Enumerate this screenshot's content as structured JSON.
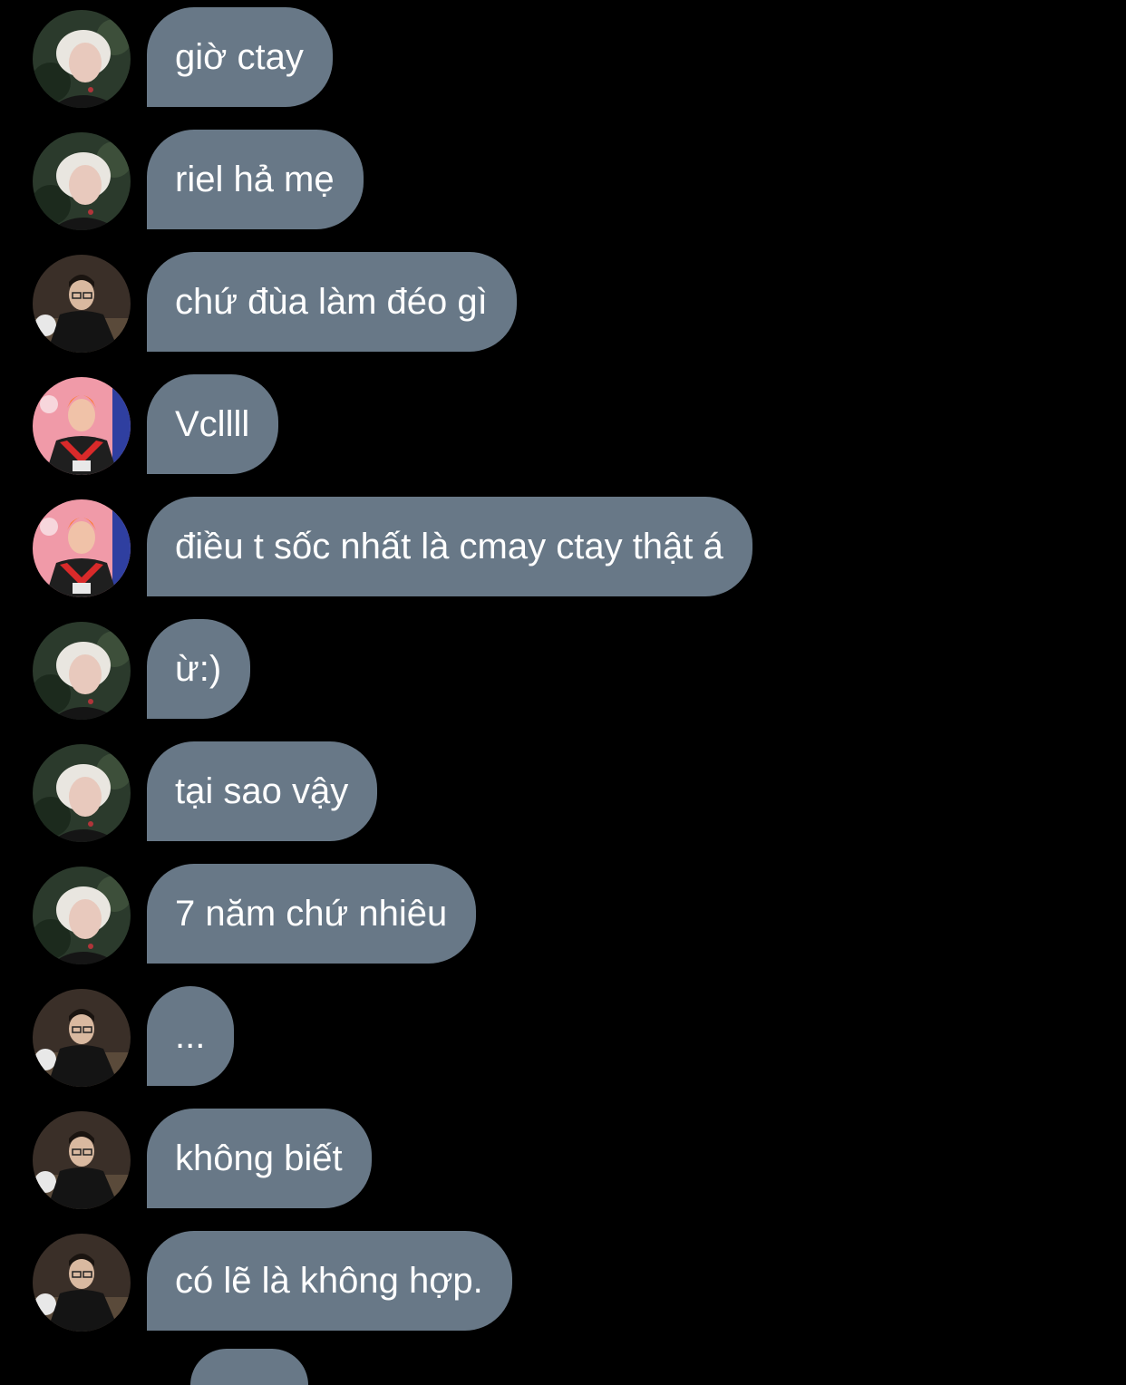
{
  "colors": {
    "background": "#000000",
    "bubble": "#687887",
    "text": "#ffffff"
  },
  "messages": [
    {
      "avatar": "avatar-blonde",
      "text": "giờ ctay"
    },
    {
      "avatar": "avatar-blonde",
      "text": "riel hả mẹ"
    },
    {
      "avatar": "avatar-glasses",
      "text": "chứ đùa làm đéo gì"
    },
    {
      "avatar": "avatar-red-hair",
      "text": "Vcllll"
    },
    {
      "avatar": "avatar-red-hair",
      "text": "điều t sốc nhất là cmay ctay thật á"
    },
    {
      "avatar": "avatar-blonde",
      "text": "ừ:)"
    },
    {
      "avatar": "avatar-blonde",
      "text": "tại sao vậy"
    },
    {
      "avatar": "avatar-blonde",
      "text": "7 năm chứ nhiêu"
    },
    {
      "avatar": "avatar-glasses",
      "text": "..."
    },
    {
      "avatar": "avatar-glasses",
      "text": "không biết"
    },
    {
      "avatar": "avatar-glasses",
      "text": "có lẽ là không hợp."
    }
  ]
}
